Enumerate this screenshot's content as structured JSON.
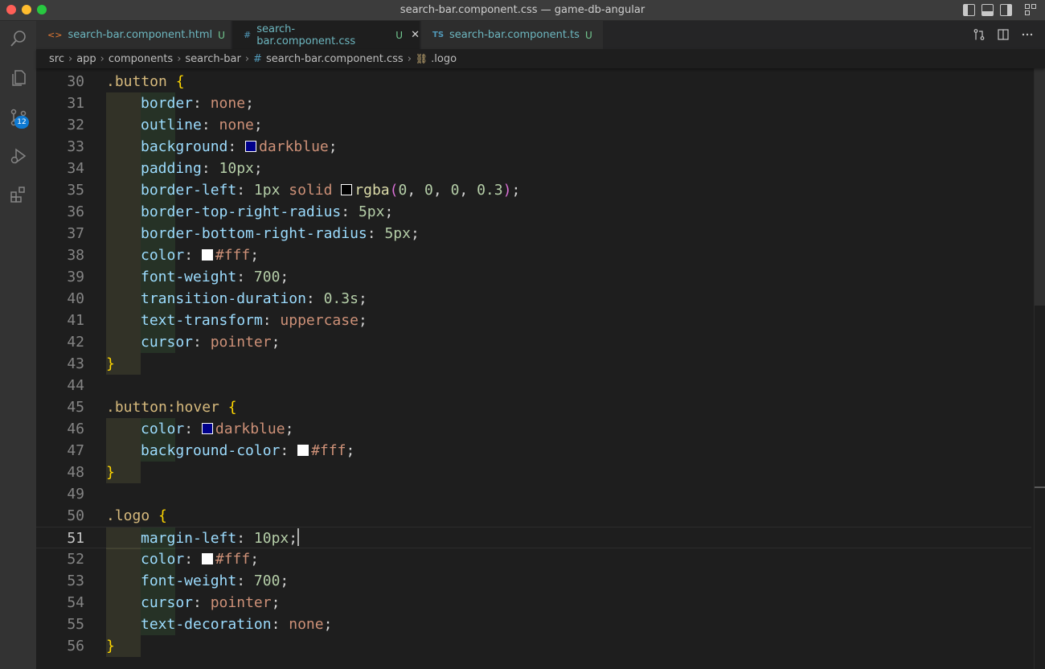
{
  "window": {
    "title": "search-bar.component.css — game-db-angular"
  },
  "activity_bar": {
    "items": [
      {
        "name": "search-icon"
      },
      {
        "name": "explorer-icon"
      },
      {
        "name": "source-control-icon",
        "badge": "12"
      },
      {
        "name": "run-debug-icon"
      },
      {
        "name": "extensions-icon"
      }
    ]
  },
  "tabs": [
    {
      "icon": "<>",
      "label": "search-bar.component.html",
      "status": "U",
      "active": false
    },
    {
      "icon": "#",
      "label": "search-bar.component.css",
      "status": "U",
      "active": true,
      "close": "✕"
    },
    {
      "icon": "TS",
      "label": "search-bar.component.ts",
      "status": "U",
      "active": false
    }
  ],
  "breadcrumb": {
    "parts": [
      "src",
      "app",
      "components",
      "search-bar"
    ],
    "file": "search-bar.component.css",
    "symbol": ".logo"
  },
  "editor": {
    "current_line": 51,
    "colors": {
      "darkblue": "#00008b",
      "white": "#ffffff",
      "black": "#000000"
    },
    "lines": [
      {
        "n": "30",
        "t": ".button {"
      },
      {
        "n": "31",
        "t": "border: none;"
      },
      {
        "n": "32",
        "t": "outline: none;"
      },
      {
        "n": "33",
        "t": "background: darkblue;"
      },
      {
        "n": "34",
        "t": "padding: 10px;"
      },
      {
        "n": "35",
        "t": "border-left: 1px solid rgba(0, 0, 0, 0.3);"
      },
      {
        "n": "36",
        "t": "border-top-right-radius: 5px;"
      },
      {
        "n": "37",
        "t": "border-bottom-right-radius: 5px;"
      },
      {
        "n": "38",
        "t": "color: #fff;"
      },
      {
        "n": "39",
        "t": "font-weight: 700;"
      },
      {
        "n": "40",
        "t": "transition-duration: 0.3s;"
      },
      {
        "n": "41",
        "t": "text-transform: uppercase;"
      },
      {
        "n": "42",
        "t": "cursor: pointer;"
      },
      {
        "n": "43",
        "t": "}"
      },
      {
        "n": "44",
        "t": ""
      },
      {
        "n": "45",
        "t": ".button:hover {"
      },
      {
        "n": "46",
        "t": "color: darkblue;"
      },
      {
        "n": "47",
        "t": "background-color: #fff;"
      },
      {
        "n": "48",
        "t": "}"
      },
      {
        "n": "49",
        "t": ""
      },
      {
        "n": "50",
        "t": ".logo {"
      },
      {
        "n": "51",
        "t": "margin-left: 10px;"
      },
      {
        "n": "52",
        "t": "color: #fff;"
      },
      {
        "n": "53",
        "t": "font-weight: 700;"
      },
      {
        "n": "54",
        "t": "cursor: pointer;"
      },
      {
        "n": "55",
        "t": "text-decoration: none;"
      },
      {
        "n": "56",
        "t": "}"
      }
    ]
  }
}
